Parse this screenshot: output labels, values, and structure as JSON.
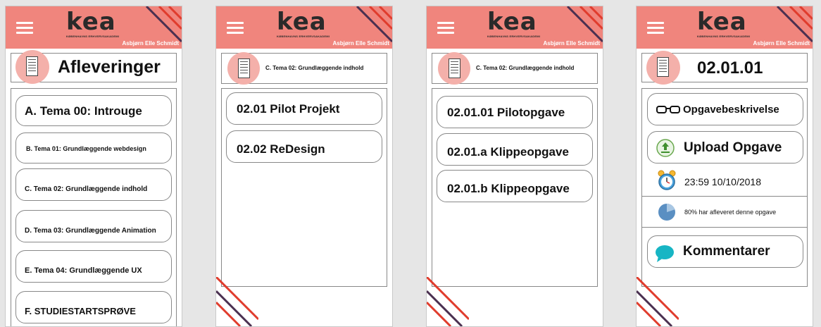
{
  "header": {
    "logo": "KEA",
    "logo_sub": "KØBENHAVNS ERHVERVSAKADEMI",
    "user": "Asbjørn Elle Schmidt",
    "color": "#f0857d"
  },
  "screen1": {
    "title": "Afleveringer",
    "items": [
      "A. Tema 00: Introuge",
      "B. Tema 01: Grundlæggende webdesign",
      "C. Tema 02: Grundlæggende indhold",
      "D. Tema 03: Grundlæggende Animation",
      "E. Tema 04: Grundlæggende UX",
      "F.  STUDIESTARTSPRØVE"
    ]
  },
  "screen2": {
    "title": "C. Tema 02: Grundlæggende indhold",
    "items": [
      "02.01 Pilot Projekt",
      "02.02 ReDesign"
    ]
  },
  "screen3": {
    "title": "C. Tema 02: Grundlæggende indhold",
    "items": [
      "02.01.01 Pilotopgave",
      "02.01.a Klippeopgave",
      "02.01.b Klippeopgave"
    ]
  },
  "screen4": {
    "title": "02.01.01",
    "description_label": "Opgavebeskrivelse",
    "upload_label": "Upload Opgave",
    "deadline": "23:59  10/10/2018",
    "progress_text": "80% har afleveret denne opgave",
    "progress_fraction": 0.8,
    "comments_label": "Kommentarer"
  },
  "icons": [
    "menu-icon",
    "document-icon",
    "glasses-icon",
    "upload-icon",
    "alarm-clock-icon",
    "pie-chart-icon",
    "speech-bubble-icon"
  ]
}
